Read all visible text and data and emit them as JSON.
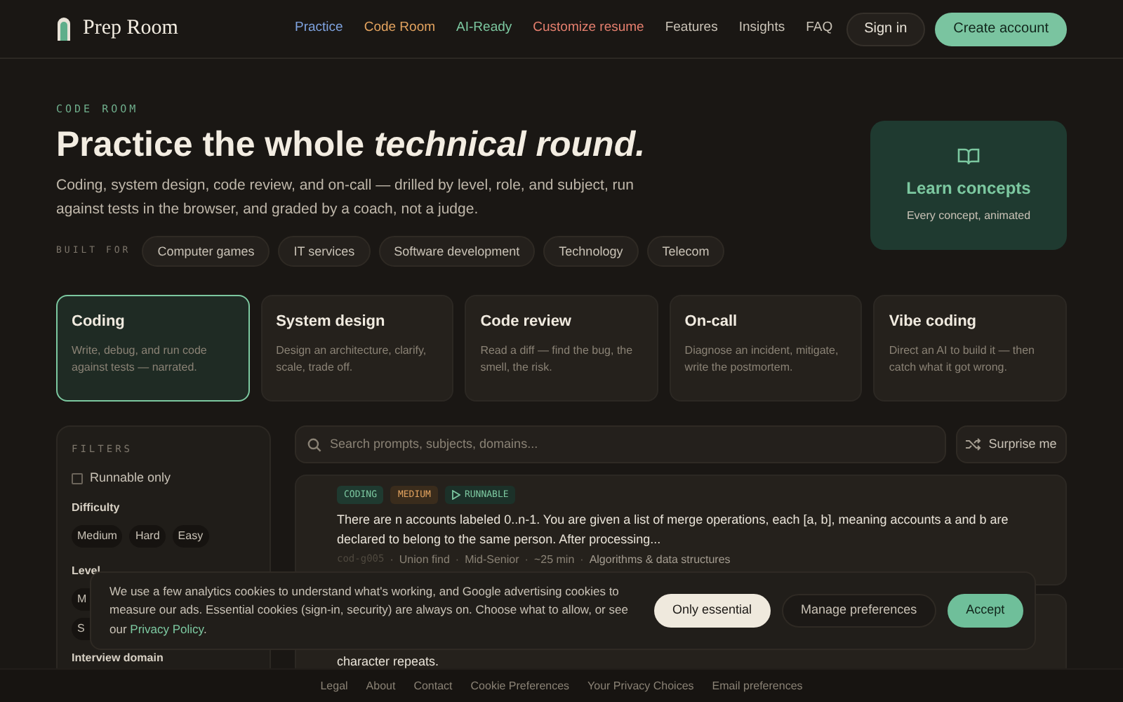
{
  "brand": {
    "name": "Prep Room"
  },
  "nav": [
    {
      "label": "Practice",
      "color": "#7fa3e0"
    },
    {
      "label": "Code Room",
      "color": "#e3a35f"
    },
    {
      "label": "AI-Ready",
      "color": "#7cc8a0"
    },
    {
      "label": "Customize resume",
      "color": "#e57f6e"
    },
    {
      "label": "Features",
      "color": "#c9c2b6"
    },
    {
      "label": "Insights",
      "color": "#c9c2b6"
    },
    {
      "label": "FAQ",
      "color": "#c9c2b6"
    }
  ],
  "header_actions": {
    "sign_in": "Sign in",
    "create_account": "Create account"
  },
  "hero": {
    "eyebrow": "CODE ROOM",
    "title": "Practice the whole *technical round.*",
    "subtitle": "Coding, system design, code review, and on-call — drilled by level, role, and subject, run against tests in the browser, and graded by a coach, not a judge.",
    "built_for_label": "BUILT FOR",
    "built_for": [
      "Computer games",
      "IT services",
      "Software development",
      "Technology",
      "Telecom"
    ]
  },
  "concepts_card": {
    "title": "Learn concepts",
    "subtitle": "Every concept, animated"
  },
  "modes": [
    {
      "title": "Coding",
      "description": "Write, debug, and run code against tests — narrated.",
      "selected": true
    },
    {
      "title": "System design",
      "description": "Design an architecture, clarify, scale, trade off.",
      "selected": false
    },
    {
      "title": "Code review",
      "description": "Read a diff — find the bug, the smell, the risk.",
      "selected": false
    },
    {
      "title": "On-call",
      "description": "Diagnose an incident, mitigate, write the postmortem.",
      "selected": false
    },
    {
      "title": "Vibe coding",
      "description": "Direct an AI to build it — then catch what it got wrong.",
      "selected": false
    }
  ],
  "filters": {
    "title": "FILTERS",
    "runnable_only": {
      "label": "Runnable only",
      "checked": false
    },
    "difficulty": {
      "label": "Difficulty",
      "options": [
        "Medium",
        "Hard",
        "Easy"
      ]
    },
    "level": {
      "label": "Level",
      "options": [
        "M",
        "S"
      ]
    },
    "interview_domain": {
      "label": "Interview domain"
    }
  },
  "search": {
    "placeholder": "Search prompts, subjects, domains..."
  },
  "surprise_button": "Surprise me",
  "problems": [
    {
      "tags": [
        {
          "label": "CODING",
          "kind": "mode"
        },
        {
          "label": "MEDIUM",
          "kind": "difficulty"
        },
        {
          "label": "RUNNABLE",
          "kind": "runnable"
        }
      ],
      "text": "There are n accounts labeled 0..n-1. You are given a list of merge operations, each [a, b], meaning accounts a and b are declared to belong to the same person. After processing...",
      "meta": [
        "cod-g005",
        "Union find",
        "Mid-Senior",
        "~25 min",
        "Algorithms & data structures"
      ],
      "meta_separator": "·"
    },
    {
      "text": "character repeats."
    }
  ],
  "cookie_banner": {
    "text": "We use a few analytics cookies to understand what's working, and Google advertising cookies to measure our ads. Essential cookies (sign-in, security) are always on. Choose what to allow, or see our",
    "link": "Privacy Policy",
    "after_link": ".",
    "buttons": [
      {
        "label": "Only essential",
        "kind": "light"
      },
      {
        "label": "Manage preferences",
        "kind": "dark"
      },
      {
        "label": "Accept",
        "kind": "accent"
      }
    ]
  },
  "footer": [
    "Legal",
    "About",
    "Contact",
    "Cookie Preferences",
    "Your Privacy Choices",
    "Email preferences"
  ]
}
